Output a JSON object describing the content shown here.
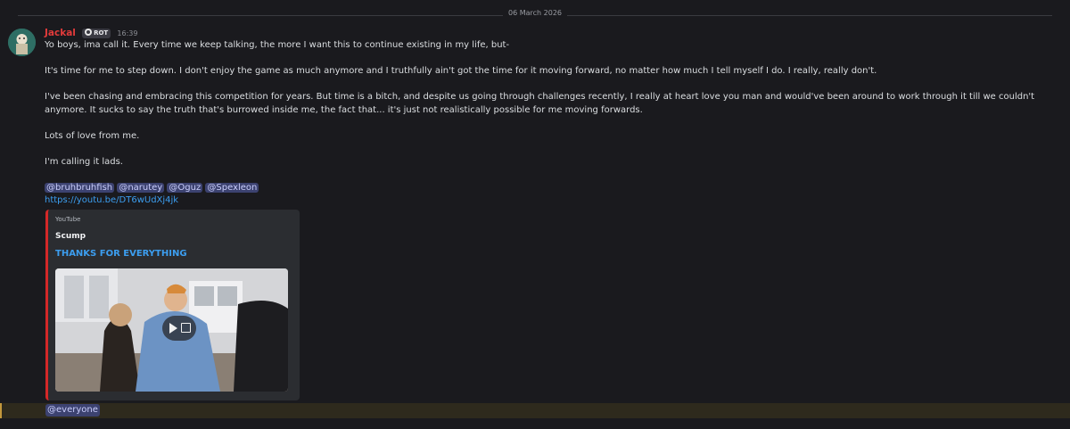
{
  "divider": {
    "date": "06 March 2026"
  },
  "message": {
    "username": "Jackal",
    "badge": "ROT",
    "timestamp": "16:39",
    "paragraphs": [
      "Yo boys, ima call it. Every time we keep talking, the more I want this to continue existing in my life, but-",
      "It's time for me to step down. I don't enjoy the game as much anymore and I truthfully ain't got the time for it moving forward, no matter how much I tell myself I do. I really, really don't.",
      "I've been chasing and embracing this competition for years. But time is a bitch, and despite us going through challenges recently, I really at heart love you man and would've been around to work through it till we couldn't anymore. It sucks to say the truth that's burrowed inside me, the fact that...  it's just not realistically possible for me moving forwards.",
      "Lots of love from me.",
      "I'm calling it lads."
    ],
    "mentions": [
      "@bruhbruhfish",
      "@narutey",
      "@Oguz",
      "@Spexleon"
    ],
    "link": "https://youtu.be/DT6wUdXj4jk",
    "embed": {
      "provider": "YouTube",
      "author": "Scump",
      "title": "THANKS FOR EVERYTHING"
    },
    "everyone": "@everyone"
  },
  "colors": {
    "accent_link": "#3c9ef0",
    "username": "#e23b3b",
    "embed_border": "#d42828",
    "mention_bg": "#3c4270"
  }
}
